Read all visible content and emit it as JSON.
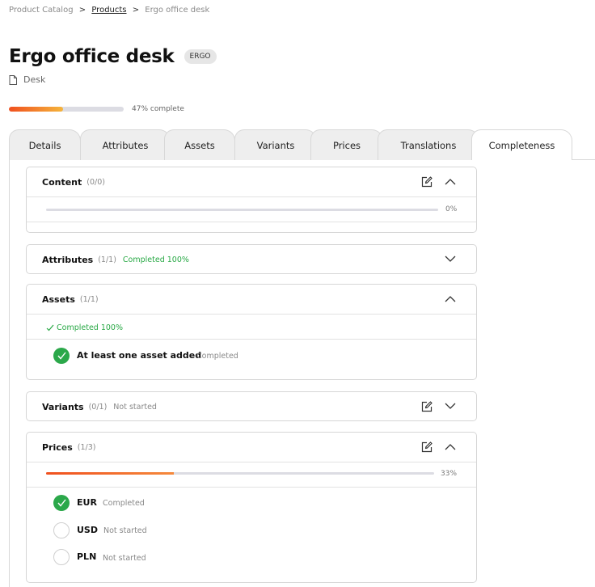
{
  "breadcrumb": {
    "root": "Product Catalog",
    "sep1": ">",
    "products": "Products",
    "sep2": ">",
    "current": "Ergo office desk"
  },
  "product": {
    "title": "Ergo office desk",
    "badge": "ERGO",
    "type": "Desk"
  },
  "completeness": {
    "percent": 47,
    "label": "47% complete"
  },
  "tabs": [
    {
      "label": "Details"
    },
    {
      "label": "Attributes"
    },
    {
      "label": "Assets"
    },
    {
      "label": "Variants"
    },
    {
      "label": "Prices"
    },
    {
      "label": "Translations"
    },
    {
      "label": "Completeness",
      "active": true
    }
  ],
  "sections": {
    "content": {
      "title": "Content",
      "count": "(0/0)",
      "percent": 0,
      "percent_label": "0%"
    },
    "attributes": {
      "title": "Attributes",
      "count": "(1/1)",
      "status": "Completed 100%"
    },
    "assets": {
      "title": "Assets",
      "count": "(1/1)",
      "summary": "Completed 100%",
      "items": [
        {
          "label": "At least one asset added",
          "status": "Completed",
          "done": true
        }
      ]
    },
    "variants": {
      "title": "Variants",
      "count": "(0/1)",
      "status": "Not started"
    },
    "prices": {
      "title": "Prices",
      "count": "(1/3)",
      "percent": 33,
      "percent_label": "33%",
      "items": [
        {
          "label": "EUR",
          "status": "Completed",
          "done": true
        },
        {
          "label": "USD",
          "status": "Not started",
          "done": false
        },
        {
          "label": "PLN",
          "status": "Not started",
          "done": false
        }
      ]
    }
  },
  "colors": {
    "accent_start": "#f0501e",
    "accent_end": "#f5b43c",
    "success": "#2ba84a"
  },
  "icons": {
    "document": "document-icon",
    "edit": "edit-icon",
    "chevron_up": "chevron-up-icon",
    "chevron_down": "chevron-down-icon",
    "check": "check-icon"
  }
}
